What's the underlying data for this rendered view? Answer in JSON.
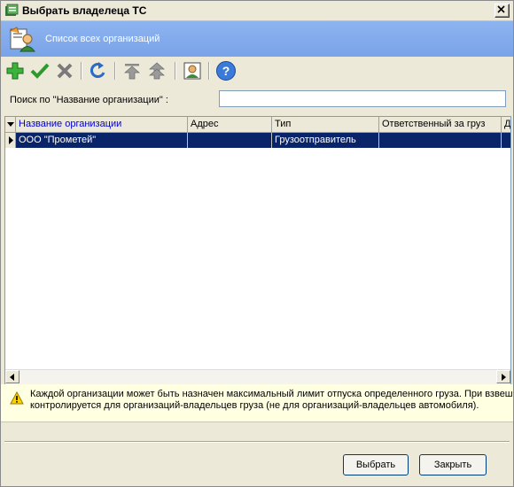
{
  "window": {
    "title": "Выбрать владелеца ТС"
  },
  "header": {
    "title": "Список всех организаций"
  },
  "toolbar": {
    "buttons": [
      {
        "name": "add-icon"
      },
      {
        "name": "check-icon"
      },
      {
        "name": "delete-icon"
      },
      {
        "name": "refresh-icon"
      },
      {
        "name": "move-top-icon"
      },
      {
        "name": "move-up-icon"
      },
      {
        "name": "contact-card-icon"
      },
      {
        "name": "help-icon"
      }
    ]
  },
  "search": {
    "label": "Поиск по \"Название организации\" :",
    "value": ""
  },
  "grid": {
    "columns": [
      "Название организации",
      "Адрес",
      "Тип",
      "Ответственный за груз",
      "Д"
    ],
    "rows": [
      [
        "ООО \"Прометей\"",
        "",
        "Грузоотправитель",
        "",
        ""
      ]
    ]
  },
  "info": {
    "line1": "Каждой организации может быть назначен максимальный лимит отпуска определенного груза. При взвеш",
    "line2": "контролируется для организаций-владельцев груза (не для организаций-владельцев автомобиля)."
  },
  "buttons": {
    "select": "Выбрать",
    "close": "Закрыть"
  },
  "colors": {
    "header_bg": "#8db4f0",
    "selection": "#0a246a",
    "info_bg": "#ffffe1"
  }
}
